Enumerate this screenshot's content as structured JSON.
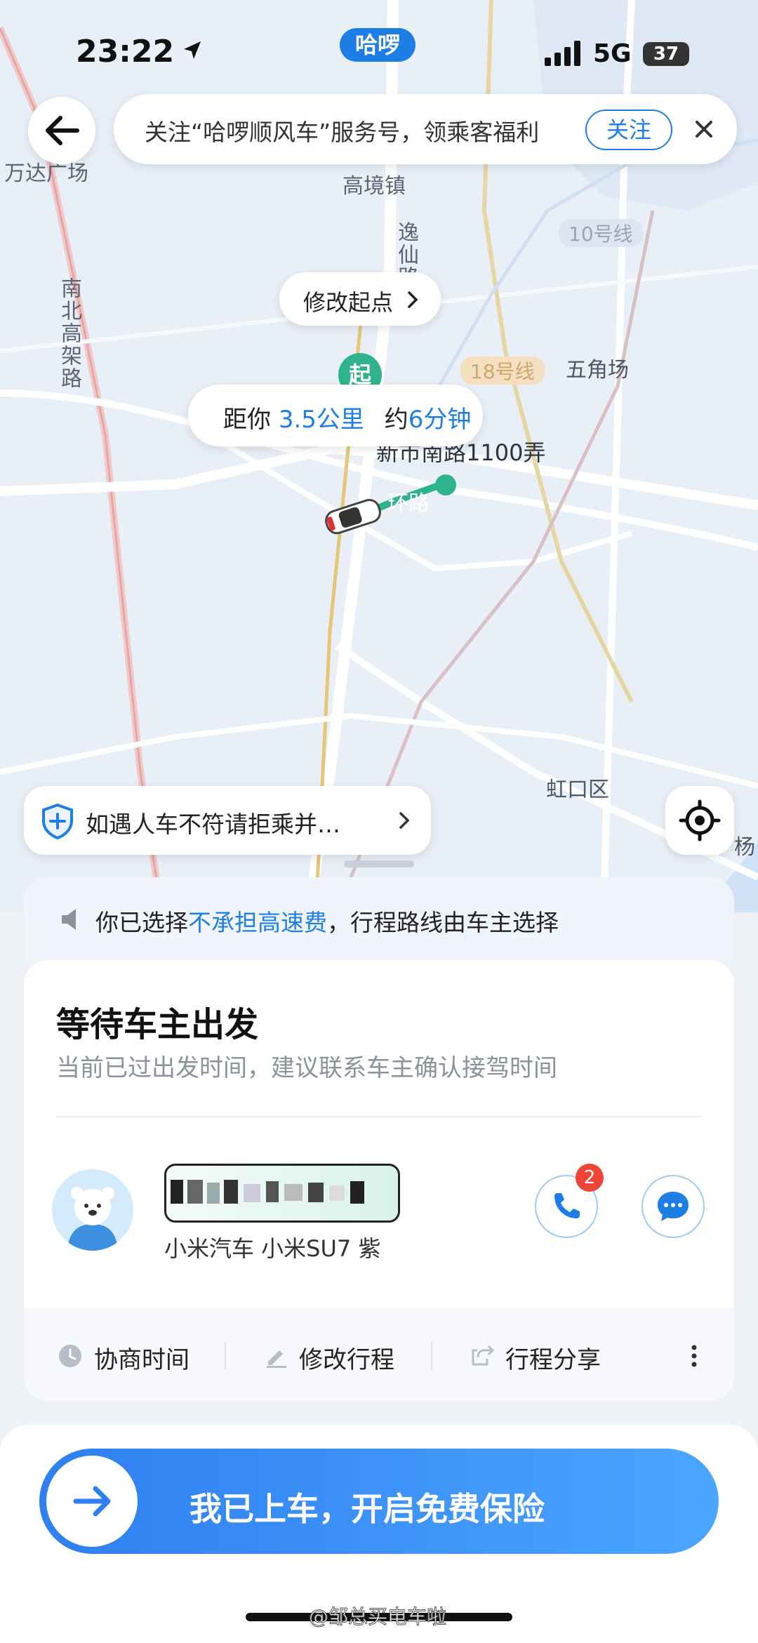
{
  "status_bar": {
    "time": "23:22",
    "app_badge": "哈啰",
    "network": "5G",
    "battery": "37"
  },
  "banner": {
    "text": "关注“哈啰顺风车”服务号，领乘客福利",
    "follow_label": "关注"
  },
  "map": {
    "labels": {
      "wanda": "万达广场",
      "gaojing": "高境镇",
      "line10": "10号线",
      "nanbei": "南北高架路",
      "yixian": "逸仙路",
      "line18": "18号线",
      "wujiaochang": "五角场",
      "xinshinan": "新市南路1100弄",
      "huanlu": "环路",
      "hongkou": "虹口区",
      "yang": "杨",
      "start_marker": "起"
    },
    "modify_start": "修改起点",
    "distance": {
      "prefix": "距你",
      "distance": "3.5公里",
      "about": "约",
      "time": "6分钟"
    }
  },
  "safety_tip": "如遇人车不符请拒乘并…",
  "notice": {
    "prefix": "你已选择",
    "highlight": "不承担高速费",
    "suffix": "，行程路线由车主选择"
  },
  "status": {
    "title": "等待车主出发",
    "subtitle": "当前已过出发时间，建议联系车主确认接驾时间"
  },
  "driver": {
    "car": "小米汽车 小米SU7 紫",
    "call_badge": "2"
  },
  "actions": [
    {
      "label": "协商时间"
    },
    {
      "label": "修改行程"
    },
    {
      "label": "行程分享"
    }
  ],
  "cta": {
    "label": "我已上车，开启免费保险"
  },
  "watermark": "@邹总买电车啦",
  "colors": {
    "accent": "#1d7fe6",
    "green": "#2fb38a",
    "badge_red": "#f04438"
  }
}
